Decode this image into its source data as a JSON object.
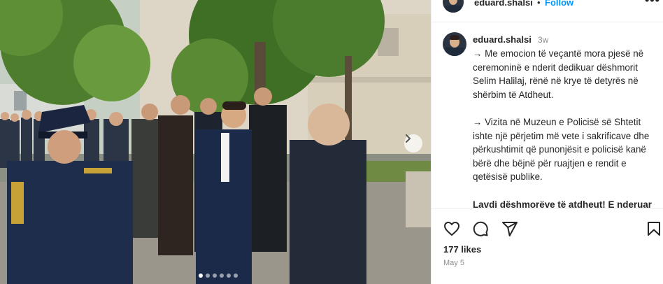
{
  "post": {
    "username": "eduard.shalsi",
    "separator": "•",
    "follow_label": "Follow",
    "more_label": "•••",
    "time_ago": "3w",
    "caption": {
      "p1": "→ Me emocion të veçantë mora pjesë në ceremoninë e nderit dedikuar dëshmorit Selim Halilaj, rënë në krye të detyrës në shërbim të Atdheut.",
      "p2": "→ Vizita në Muzeun e Policisë së Shtetit ishte një përjetim më vete i sakrificave dhe përkushtimit që punonjësit e policisë kanë bërë dhe bëjnë për ruajtjen e rendit e qetësisë publike.",
      "p3": "Lavdi dëshmorëve të atdheut! E nderuar vepra e tyre!"
    },
    "likes": "177 likes",
    "date": "May 5"
  },
  "carousel": {
    "total": 6,
    "active_index": 0
  },
  "icons": {
    "like": "heart-icon",
    "comment": "comment-icon",
    "share": "share-icon",
    "save": "bookmark-icon",
    "next": "chevron-right-icon"
  },
  "colors": {
    "link": "#0095f6",
    "muted": "#8e8e8e",
    "text": "#262626"
  }
}
